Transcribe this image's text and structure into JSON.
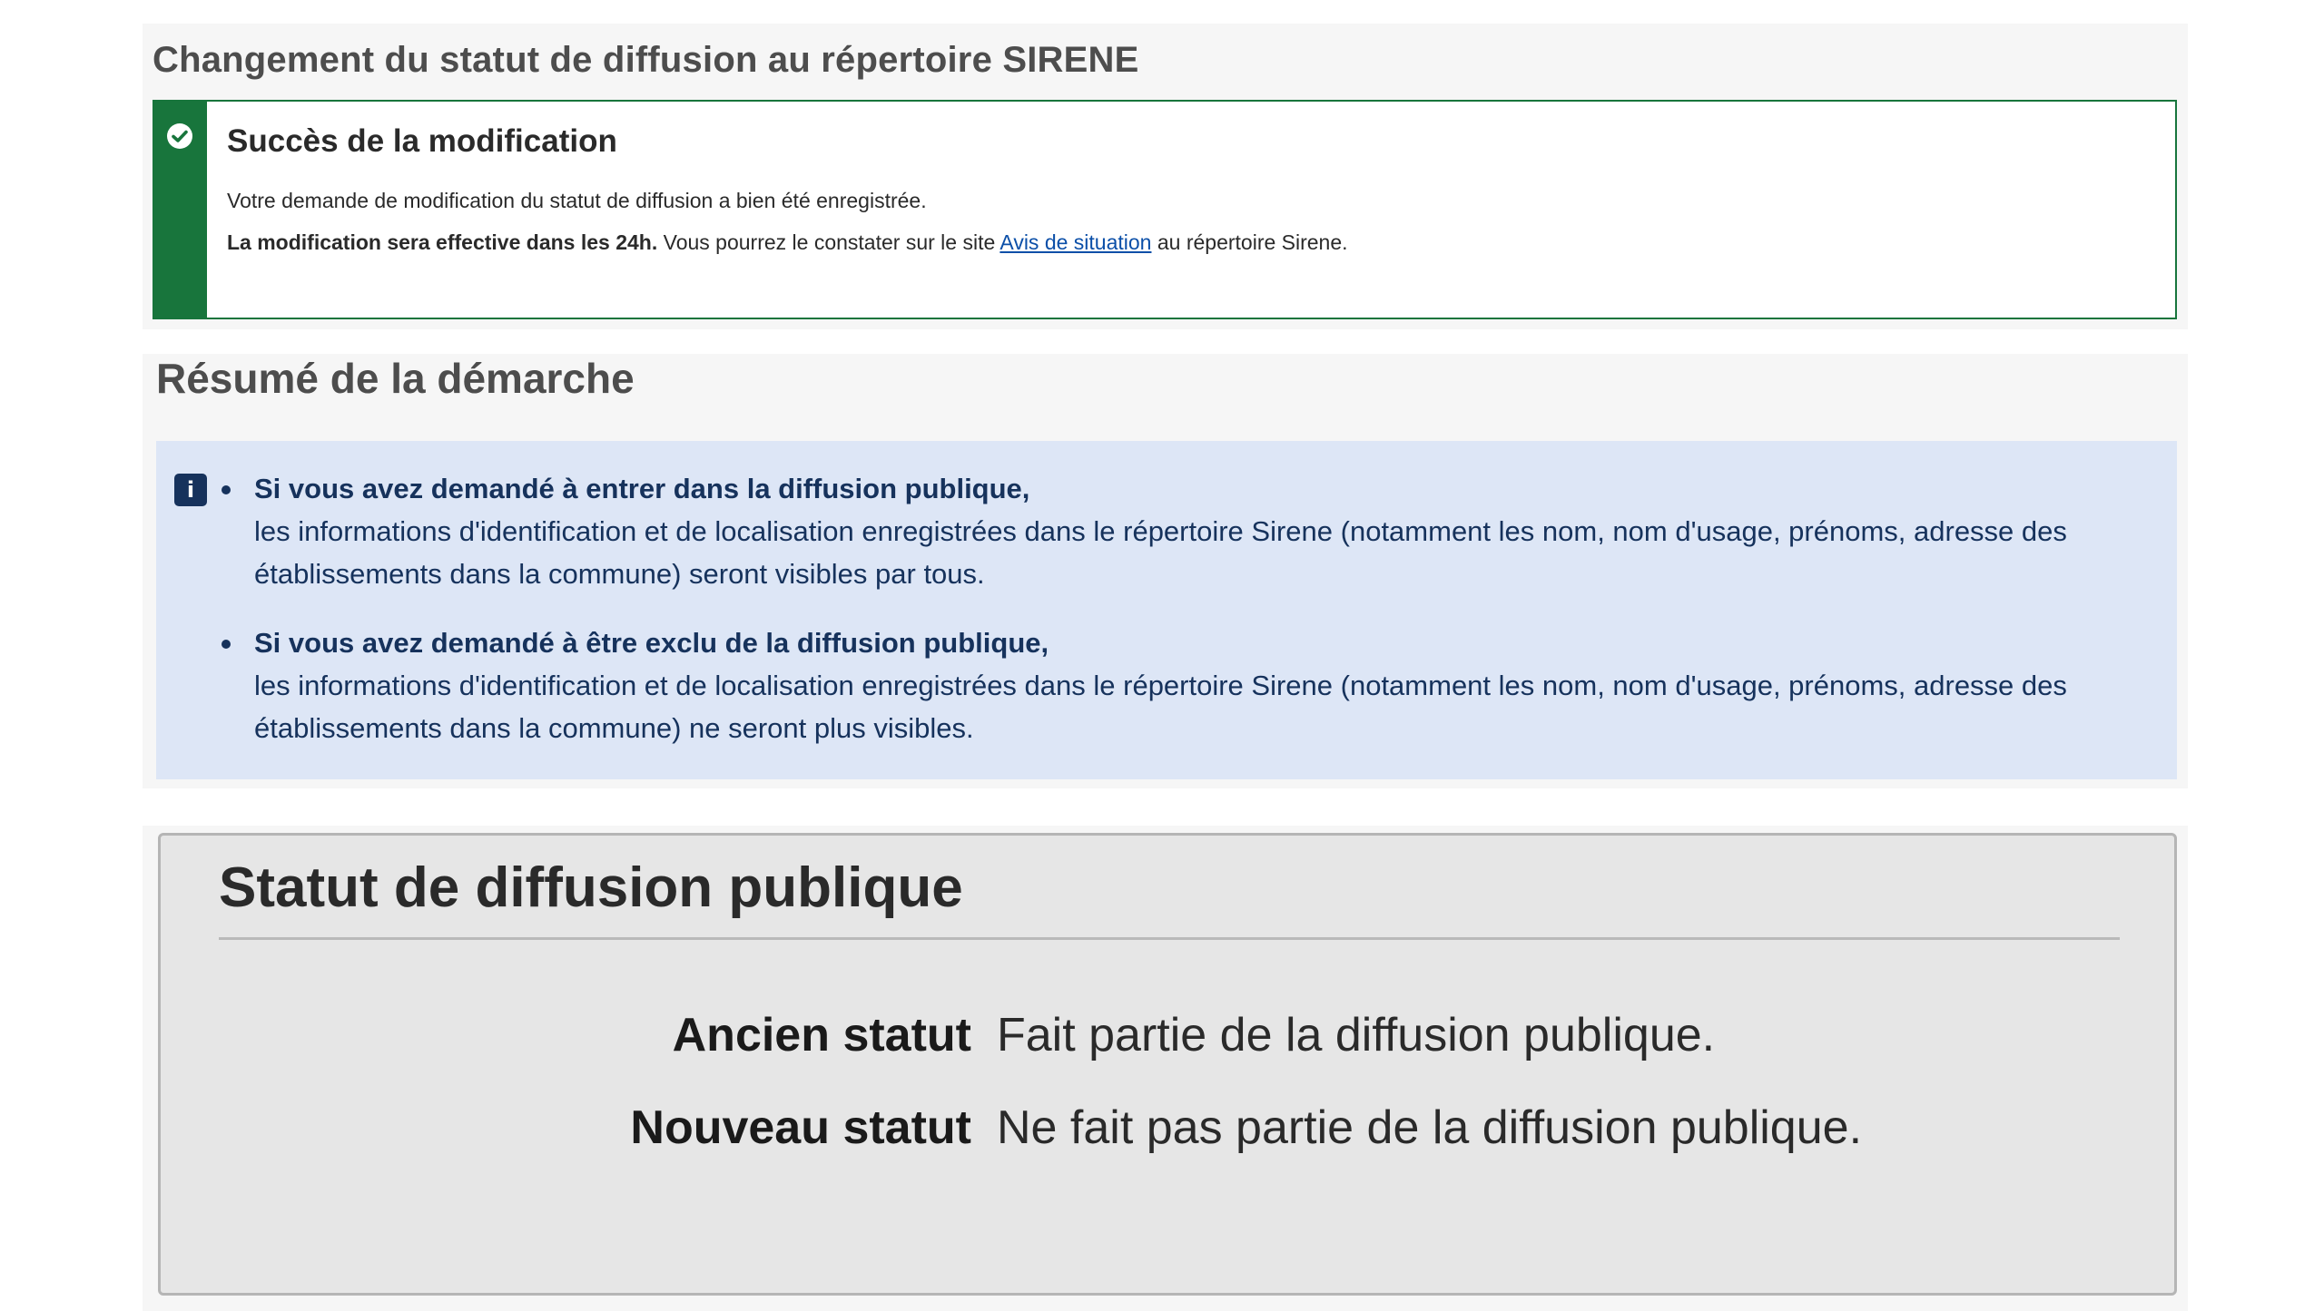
{
  "header": {
    "title": "Changement du statut de diffusion au répertoire SIRENE"
  },
  "success_alert": {
    "icon": "check-circle-icon",
    "title": "Succès de la modification",
    "line1": "Votre demande de modification du statut de diffusion a bien été enregistrée.",
    "line2_bold": "La modification sera effective dans les 24h.",
    "line2_before_link": " Vous pourrez le constater sur le site ",
    "link_text": "Avis de situation",
    "line2_after_link": " au répertoire Sirene.",
    "color": "#18753c"
  },
  "summary": {
    "title": "Résumé de la démarche",
    "info_icon": "info-icon",
    "items": [
      {
        "lead": "Si vous avez demandé à entrer dans la diffusion publique,",
        "text": "les informations d'identification et de localisation enregistrées dans le répertoire Sirene (notamment les nom, nom d'usage, prénoms, adresse des établissements dans la commune) seront visibles par tous."
      },
      {
        "lead": "Si vous avez demandé à être exclu de la diffusion publique,",
        "text": "les informations d'identification et de localisation enregistrées dans le répertoire Sirene (notamment les nom, nom d'usage, prénoms, adresse des établissements dans la commune) ne seront plus visibles."
      }
    ]
  },
  "status": {
    "title": "Statut de diffusion publique",
    "old_label": "Ancien statut",
    "old_value": "Fait partie de la diffusion publique.",
    "new_label": "Nouveau statut",
    "new_value": "Ne fait pas partie de la diffusion publique."
  }
}
